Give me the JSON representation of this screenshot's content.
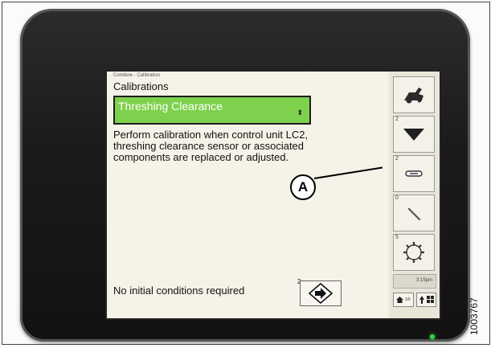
{
  "screen": {
    "breadcrumb": "Combine - Calibration",
    "title": "Calibrations",
    "dropdown": {
      "value": "Threshing Clearance",
      "arrow": "⬍"
    },
    "description": "Perform calibration when control unit LC2, threshing clearance sensor or associated components are replaced or adjusted.",
    "status": "No initial conditions required",
    "next_button": {
      "number": "2"
    }
  },
  "sidebar": {
    "buttons": [
      {
        "number": "",
        "icon": "combine-icon"
      },
      {
        "number": "2",
        "icon": "down-arrow-icon"
      },
      {
        "number": "2",
        "icon": "sensor-icon"
      },
      {
        "number": "0",
        "icon": "wrench-icon"
      },
      {
        "number": "5",
        "icon": "gear-icon"
      }
    ],
    "time": "3:15pm",
    "home_page": "1/5"
  },
  "callout": {
    "label": "A"
  },
  "figure_number": "1003767",
  "colors": {
    "dropdown_bg": "#7fd14d",
    "screen_bg": "#f5f3e8",
    "led": "#36d34a"
  }
}
